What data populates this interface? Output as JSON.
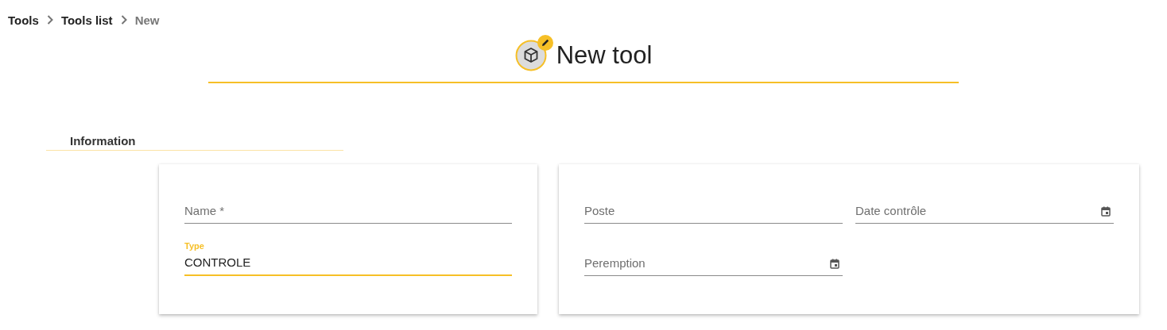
{
  "breadcrumb": [
    {
      "label": "Tools",
      "current": false
    },
    {
      "label": "Tools list",
      "current": false
    },
    {
      "label": "New",
      "current": true
    }
  ],
  "header": {
    "title": "New tool"
  },
  "section": {
    "title": "Information"
  },
  "cards": [
    {
      "fields": [
        {
          "kind": "text",
          "placeholder": "Name *",
          "focused": false
        },
        {
          "kind": "text",
          "label": "Type",
          "value": "CONTROLE",
          "focused": true
        }
      ]
    },
    {
      "fields": [
        {
          "kind": "text",
          "placeholder": "Poste",
          "focused": false
        },
        {
          "kind": "date",
          "placeholder": "Date contrôle",
          "focused": false
        },
        {
          "kind": "date",
          "placeholder": "Peremption",
          "focused": false
        }
      ]
    }
  ]
}
